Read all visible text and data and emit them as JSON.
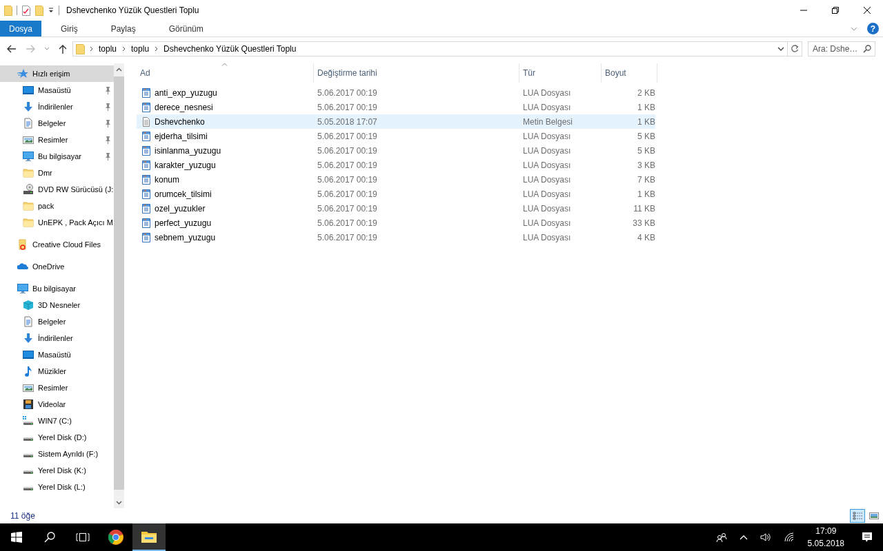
{
  "window": {
    "title": "Dshevchenko Yüzük Questleri Toplu"
  },
  "ribbon": {
    "tabs": [
      {
        "label": "Dosya",
        "selected": true
      },
      {
        "label": "Giriş",
        "selected": false
      },
      {
        "label": "Paylaş",
        "selected": false
      },
      {
        "label": "Görünüm",
        "selected": false
      }
    ],
    "help": "?"
  },
  "address": {
    "segments": [
      "toplu",
      "toplu",
      "Dshevchenko Yüzük Questleri Toplu"
    ],
    "search_placeholder": "Ara: Dshe…"
  },
  "sidebar": {
    "items": [
      {
        "label": "Hızlı erişim",
        "kind": "quick-access",
        "selected": true,
        "children": [
          {
            "label": "Masaüstü",
            "kind": "desktop",
            "pinned": true,
            "selected": false
          },
          {
            "label": "İndirilenler",
            "kind": "downloads",
            "pinned": true,
            "selected": false
          },
          {
            "label": "Belgeler",
            "kind": "documents",
            "pinned": true,
            "selected": false
          },
          {
            "label": "Resimler",
            "kind": "pictures",
            "pinned": true,
            "selected": false
          },
          {
            "label": "Bu bilgisayar",
            "kind": "computer",
            "pinned": true,
            "selected": false
          },
          {
            "label": "Dmr",
            "kind": "folder",
            "pinned": false,
            "selected": false
          },
          {
            "label": "DVD RW Sürücüsü (J:",
            "kind": "dvd",
            "pinned": false,
            "selected": false
          },
          {
            "label": "pack",
            "kind": "folder",
            "pinned": false,
            "selected": false
          },
          {
            "label": "UnEPK , Pack Açıcı M",
            "kind": "folder",
            "pinned": false,
            "selected": false
          }
        ]
      },
      {
        "label": "Creative Cloud Files",
        "kind": "cloud-folder",
        "selected": false
      },
      {
        "label": "OneDrive",
        "kind": "onedrive",
        "selected": false
      },
      {
        "label": "Bu bilgisayar",
        "kind": "computer",
        "selected": false,
        "children": [
          {
            "label": "3D Nesneler",
            "kind": "objects-3d",
            "selected": false
          },
          {
            "label": "Belgeler",
            "kind": "documents",
            "selected": false
          },
          {
            "label": "İndirilenler",
            "kind": "downloads",
            "selected": false
          },
          {
            "label": "Masaüstü",
            "kind": "desktop",
            "selected": false
          },
          {
            "label": "Müzikler",
            "kind": "music",
            "selected": false
          },
          {
            "label": "Resimler",
            "kind": "pictures",
            "selected": false
          },
          {
            "label": "Videolar",
            "kind": "videos",
            "selected": false
          },
          {
            "label": "WIN7 (C:)",
            "kind": "system-drive",
            "selected": false
          },
          {
            "label": "Yerel Disk (D:)",
            "kind": "drive",
            "selected": false
          },
          {
            "label": "Sistem Ayrıldı (F:)",
            "kind": "drive",
            "selected": false
          },
          {
            "label": "Yerel Disk (K:)",
            "kind": "drive",
            "selected": false
          },
          {
            "label": "Yerel Disk (L:)",
            "kind": "drive",
            "selected": false
          }
        ]
      }
    ]
  },
  "table": {
    "columns": [
      {
        "label": "Ad",
        "sorted": true
      },
      {
        "label": "Değiştirme tarihi",
        "sorted": false
      },
      {
        "label": "Tür",
        "sorted": false
      },
      {
        "label": "Boyut",
        "sorted": false
      }
    ],
    "rows": [
      {
        "name": "anti_exp_yuzugu",
        "modified": "5.06.2017 00:19",
        "type": "LUA Dosyası",
        "size": "2 KB",
        "kind": "lua",
        "highlighted": false
      },
      {
        "name": "derece_nesnesi",
        "modified": "5.06.2017 00:19",
        "type": "LUA Dosyası",
        "size": "1 KB",
        "kind": "lua",
        "highlighted": false
      },
      {
        "name": "Dshevchenko",
        "modified": "5.05.2018 17:07",
        "type": "Metin Belgesi",
        "size": "1 KB",
        "kind": "text",
        "highlighted": true
      },
      {
        "name": "ejderha_tilsimi",
        "modified": "5.06.2017 00:19",
        "type": "LUA Dosyası",
        "size": "5 KB",
        "kind": "lua",
        "highlighted": false
      },
      {
        "name": "isinlanma_yuzugu",
        "modified": "5.06.2017 00:19",
        "type": "LUA Dosyası",
        "size": "5 KB",
        "kind": "lua",
        "highlighted": false
      },
      {
        "name": "karakter_yuzugu",
        "modified": "5.06.2017 00:19",
        "type": "LUA Dosyası",
        "size": "3 KB",
        "kind": "lua",
        "highlighted": false
      },
      {
        "name": "konum",
        "modified": "5.06.2017 00:19",
        "type": "LUA Dosyası",
        "size": "7 KB",
        "kind": "lua",
        "highlighted": false
      },
      {
        "name": "orumcek_tilsimi",
        "modified": "5.06.2017 00:19",
        "type": "LUA Dosyası",
        "size": "1 KB",
        "kind": "lua",
        "highlighted": false
      },
      {
        "name": "ozel_yuzukler",
        "modified": "5.06.2017 00:19",
        "type": "LUA Dosyası",
        "size": "11 KB",
        "kind": "lua",
        "highlighted": false
      },
      {
        "name": "perfect_yuzugu",
        "modified": "5.06.2017 00:19",
        "type": "LUA Dosyası",
        "size": "33 KB",
        "kind": "lua",
        "highlighted": false
      },
      {
        "name": "sebnem_yuzugu",
        "modified": "5.06.2017 00:19",
        "type": "LUA Dosyası",
        "size": "4 KB",
        "kind": "lua",
        "highlighted": false
      }
    ]
  },
  "status_bar": {
    "count": "11 öğe",
    "views": [
      {
        "kind": "details",
        "selected": true
      },
      {
        "kind": "large-icons",
        "selected": false
      }
    ]
  },
  "taskbar": {
    "apps": [
      {
        "kind": "browser",
        "active": false
      },
      {
        "kind": "explorer",
        "active": true
      }
    ],
    "time": "17:09",
    "date": "5.05.2018"
  }
}
